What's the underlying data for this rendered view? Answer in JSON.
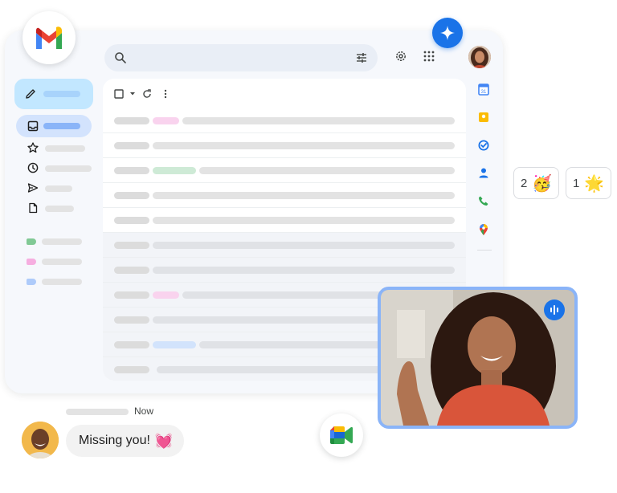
{
  "chat": {
    "timestamp": "Now",
    "message": "Missing you!",
    "emoji": "💓"
  },
  "reactions": [
    {
      "count": "2",
      "emoji": "🥳"
    },
    {
      "count": "1",
      "emoji": "🌟"
    }
  ],
  "colors": {
    "accent_blue": "#1a73e8",
    "compose_bg": "#c2e7ff",
    "nav_active_bg": "#d3e3fd",
    "video_border": "#8ab4f8",
    "label_green": "#81c995",
    "label_pink": "#f6aee0",
    "label_blue": "#aecbfa"
  },
  "icons": {
    "logo": "gmail-logo",
    "search": "search-icon",
    "filter": "tune-icon",
    "settings": "gear-icon",
    "apps": "apps-grid-icon",
    "gemini": "sparkle-icon",
    "meet": "google-meet-logo"
  }
}
